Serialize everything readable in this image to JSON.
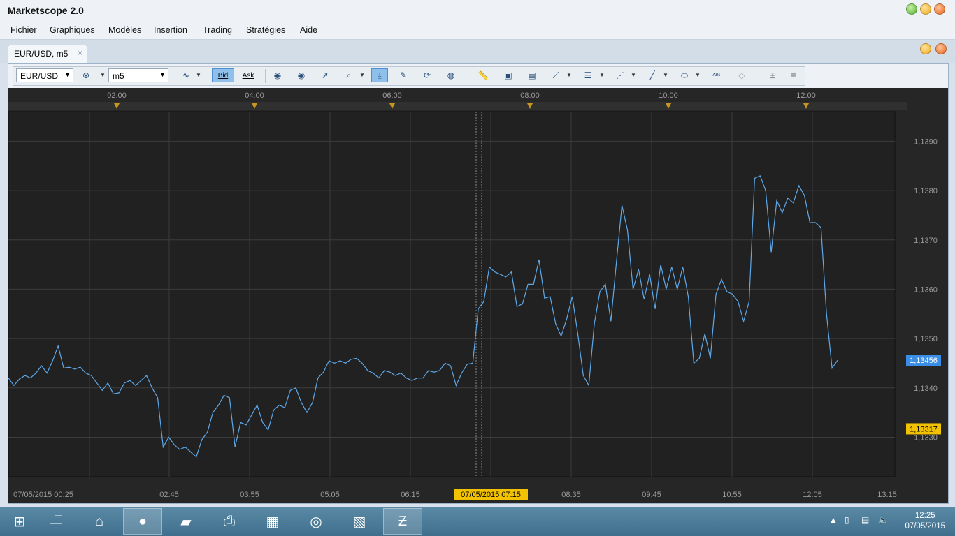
{
  "window": {
    "title": "Marketscope 2.0"
  },
  "menu": [
    "Fichier",
    "Graphiques",
    "Modèles",
    "Insertion",
    "Trading",
    "Stratégies",
    "Aide"
  ],
  "tab": {
    "label": "EUR/USD, m5",
    "close": "×"
  },
  "toolbar": {
    "symbol": "EUR/USD",
    "timeframe": "m5",
    "bid_label": "Bid",
    "ask_label": "Ask"
  },
  "colors": {
    "chart_bg": "#212121",
    "line": "#5fa8e8",
    "grid": "#3c3c3c",
    "current_price_bg": "#3a8ee6",
    "cursor_price_bg": "#f2c200"
  },
  "chart_data": {
    "type": "line",
    "series": [
      {
        "instrument": "EUR/USD",
        "values": [
          1.1342,
          1.13405,
          1.13418,
          1.13425,
          1.1342,
          1.1343,
          1.13445,
          1.1343,
          1.13455,
          1.13485,
          1.1344,
          1.13442,
          1.13438,
          1.13442,
          1.1343,
          1.13425,
          1.1341,
          1.13395,
          1.1341,
          1.13388,
          1.1339,
          1.1341,
          1.13415,
          1.13405,
          1.13415,
          1.13425,
          1.134,
          1.1338,
          1.1328,
          1.133,
          1.13285,
          1.13275,
          1.1328,
          1.1327,
          1.1326,
          1.13295,
          1.1331,
          1.1335,
          1.13365,
          1.13385,
          1.1338,
          1.1328,
          1.1333,
          1.13325,
          1.13345,
          1.13365,
          1.1333,
          1.13315,
          1.13355,
          1.13365,
          1.1336,
          1.13395,
          1.134,
          1.1337,
          1.1335,
          1.1337,
          1.1342,
          1.13432,
          1.13455,
          1.1345,
          1.13455,
          1.1345,
          1.13458,
          1.1346,
          1.1345,
          1.13435,
          1.1343,
          1.1342,
          1.13435,
          1.13432,
          1.13425,
          1.1343,
          1.1342,
          1.13415,
          1.1342,
          1.1342,
          1.13435,
          1.13432,
          1.13435,
          1.1345,
          1.13445,
          1.13405,
          1.1343,
          1.13448,
          1.1345,
          1.1356,
          1.13575,
          1.13645,
          1.13635,
          1.1363,
          1.13625,
          1.13635,
          1.13565,
          1.1357,
          1.1361,
          1.1361,
          1.1366,
          1.13582,
          1.13585,
          1.1353,
          1.13505,
          1.1354,
          1.13585,
          1.1351,
          1.13425,
          1.13405,
          1.1353,
          1.13595,
          1.1361,
          1.13535,
          1.13655,
          1.1377,
          1.1372,
          1.136,
          1.1364,
          1.1358,
          1.1363,
          1.1356,
          1.1365,
          1.136,
          1.13645,
          1.136,
          1.13645,
          1.13585,
          1.1345,
          1.1346,
          1.1351,
          1.1346,
          1.1359,
          1.1362,
          1.13595,
          1.1359,
          1.13575,
          1.13535,
          1.13575,
          1.13825,
          1.1383,
          1.138,
          1.13675,
          1.1378,
          1.13755,
          1.13785,
          1.13775,
          1.1381,
          1.1379,
          1.13735,
          1.13735,
          1.13725,
          1.1355,
          1.1344,
          1.13456
        ]
      }
    ],
    "y_ticks": [
      "1,1330",
      "1,1340",
      "1,1350",
      "1,1360",
      "1,1370",
      "1,1380",
      "1,1390"
    ],
    "ylim": [
      1.1322,
      1.1396
    ],
    "x_top_ticks": [
      "02:00",
      "04:00",
      "06:00",
      "08:00",
      "10:00",
      "12:00"
    ],
    "x_bottom_ticks": [
      "07/05/2015 00:25",
      "02:45",
      "03:55",
      "05:05",
      "06:15",
      "07/05/2015 07:15",
      "08:35",
      "09:45",
      "10:55",
      "12:05",
      "13:15"
    ],
    "current_price_label": "1,13456",
    "cursor_price_label": "1,13317",
    "cursor_price_value": 1.13317,
    "cursor_time_label": "07/05/2015 07:15"
  },
  "taskbar": {
    "apps": [
      "start-icon",
      "file-explorer-icon",
      "home-icon",
      "firefox-icon",
      "notes-icon",
      "printer-icon",
      "calculator-icon",
      "chrome-icon",
      "photo-viewer-icon",
      "marketscope-icon"
    ],
    "time": "12:25",
    "date": "07/05/2015"
  }
}
